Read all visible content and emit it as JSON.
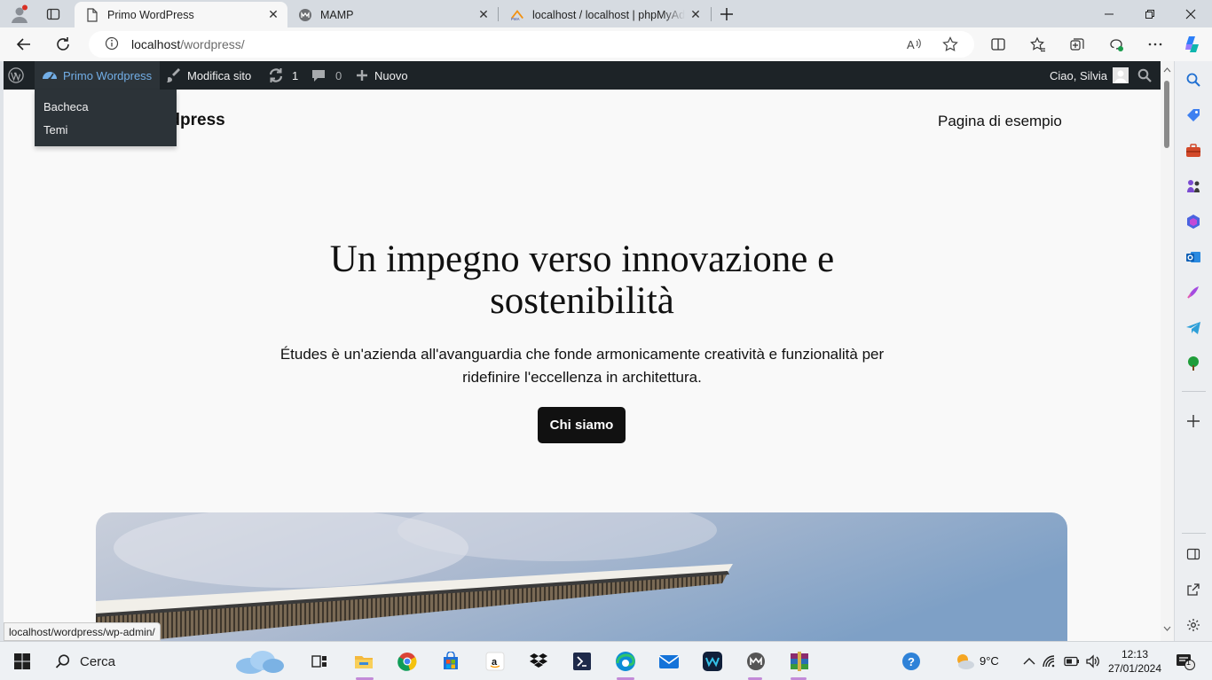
{
  "browser": {
    "tabs": [
      {
        "title": "Primo WordPress",
        "active": true
      },
      {
        "title": "MAMP",
        "active": false
      },
      {
        "title": "localhost / localhost | phpMyAdmin",
        "active": false
      }
    ],
    "url_host": "localhost",
    "url_path": "/wordpress/",
    "status_url": "localhost/wordpress/wp-admin/"
  },
  "wp_admin_bar": {
    "site_name": "Primo Wordpress",
    "edit_site": "Modifica sito",
    "updates_count": "1",
    "comments_count": "0",
    "new_label": "Nuovo",
    "greeting": "Ciao, Silvia",
    "submenu": [
      "Bacheca",
      "Temi"
    ]
  },
  "site": {
    "title_visible": "rdpress",
    "nav_link": "Pagina di esempio",
    "hero_heading": "Un impegno verso innovazione e sostenibilità",
    "hero_text": "Études è un'azienda all'avanguardia che fonde armonicamente creatività e funzionalità per ridefinire l'eccellenza in architettura.",
    "hero_button": "Chi siamo"
  },
  "taskbar": {
    "search_placeholder": "Cerca",
    "weather_temp": "9°C",
    "time": "12:13",
    "date": "27/01/2024",
    "notification_count": "1"
  }
}
